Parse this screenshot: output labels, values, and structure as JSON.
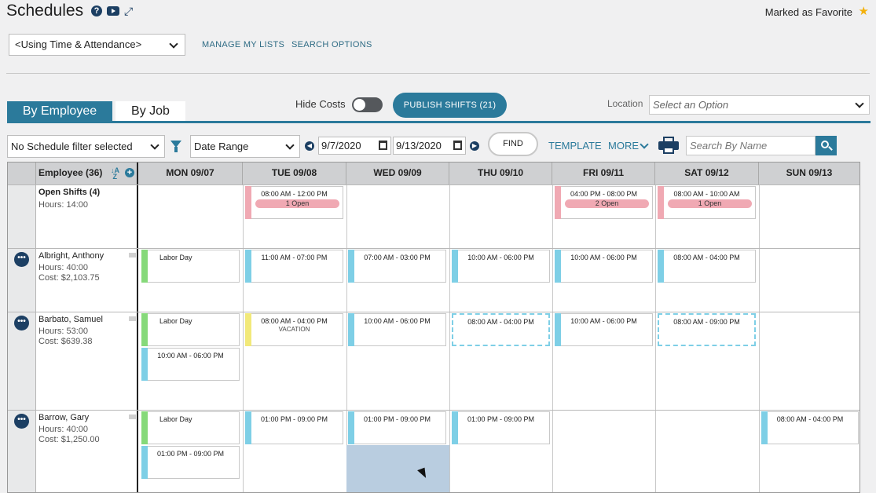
{
  "header": {
    "title": "Schedules",
    "favorite_label": "Marked as Favorite"
  },
  "toolbar1": {
    "list_select_value": "<Using Time & Attendance>",
    "manage_lists": "MANAGE MY LISTS",
    "search_options": "SEARCH OPTIONS"
  },
  "tabs": {
    "by_employee": "By Employee",
    "by_job": "By Job"
  },
  "controls": {
    "hide_costs": "Hide Costs",
    "publish": "PUBLISH SHIFTS (21)",
    "location_label": "Location",
    "location_placeholder": "Select an Option"
  },
  "filters": {
    "schedule_filter": "No Schedule filter selected",
    "date_range": "Date Range",
    "start_date": "9/7/2020",
    "end_date": "9/13/2020",
    "find": "FIND",
    "template": "TEMPLATE",
    "more": "MORE",
    "search_placeholder": "Search By Name"
  },
  "grid": {
    "employee_header": "Employee (36)",
    "days": [
      "MON 09/07",
      "TUE 09/08",
      "WED 09/09",
      "THU 09/10",
      "FRI 09/11",
      "SAT 09/12",
      "SUN 09/13"
    ],
    "open_shifts": {
      "name": "Open Shifts (4)",
      "hours": "Hours: 14:00",
      "shifts": [
        {
          "time": "08:00 AM - 12:00 PM",
          "open": "1 Open"
        },
        {
          "time": "04:00 PM - 08:00 PM",
          "open": "2 Open"
        },
        {
          "time": "08:00 AM - 10:00 AM",
          "open": "1 Open"
        }
      ]
    },
    "employees": [
      {
        "name": "Albright, Anthony",
        "hours": "Hours: 40:00",
        "cost": "Cost: $2,103.75",
        "shifts": [
          "Labor Day",
          "11:00 AM - 07:00 PM",
          "07:00 AM - 03:00 PM",
          "10:00 AM - 06:00 PM",
          "10:00 AM - 06:00 PM",
          "08:00 AM - 04:00 PM"
        ]
      },
      {
        "name": "Barbato, Samuel",
        "hours": "Hours: 53:00",
        "cost": "Cost: $639.38",
        "shifts": [
          "Labor Day",
          "10:00 AM - 06:00 PM",
          "08:00 AM - 04:00 PM",
          "10:00 AM - 06:00 PM",
          "08:00 AM - 04:00 PM",
          "10:00 AM - 06:00 PM",
          "08:00 AM - 09:00 PM"
        ],
        "vacation": "VACATION"
      },
      {
        "name": "Barrow, Gary",
        "hours": "Hours: 40:00",
        "cost": "Cost: $1,250.00",
        "shifts": [
          "Labor Day",
          "01:00 PM - 09:00 PM",
          "01:00 PM - 09:00 PM",
          "01:00 PM - 09:00 PM",
          "01:00 PM - 09:00 PM",
          "08:00 AM - 04:00 PM"
        ]
      }
    ]
  },
  "colors": {
    "primary": "#2b7a9b",
    "dark": "#1c3f63",
    "shift_blue": "#7ecfe6",
    "shift_green": "#86d97a",
    "shift_yellow": "#f2e97a",
    "shift_pink": "#f0a9b3"
  }
}
